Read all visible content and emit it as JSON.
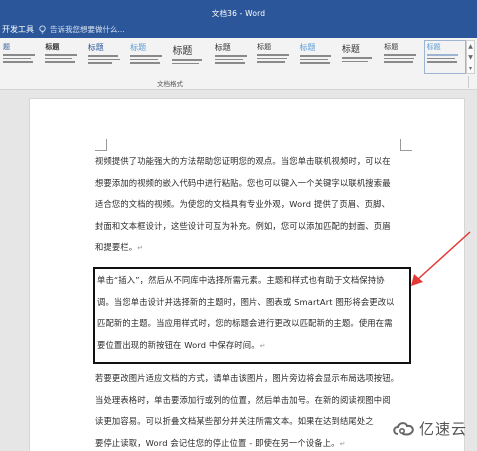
{
  "window": {
    "title": "文档36 - Word"
  },
  "ribbon": {
    "tab_developer": "开发工具",
    "tellme_placeholder": "告诉我您想要做什么...",
    "group_label": "文档格式",
    "styles": [
      "题",
      "标题",
      "标题",
      "标题",
      "标题",
      "标题",
      "标题",
      "标题",
      "标题",
      "标题",
      "标题"
    ]
  },
  "document": {
    "para1_lines": [
      "视频提供了功能强大的方法帮助您证明您的观点。当您单击联机视频时，可以在",
      "想要添加的视频的嵌入代码中进行粘贴。您也可以键入一个关键字以联机搜索最",
      "适合您的文档的视频。为使您的文档具有专业外观，Word 提供了页眉、页脚、",
      "封面和文本框设计，这些设计可互为补充。例如，您可以添加匹配的封面、页眉",
      "和提要栏。"
    ],
    "para2_lines": [
      "单击“插入”，然后从不同库中选择所需元素。主题和样式也有助于文档保持协",
      "调。当您单击设计并选择新的主题时，图片、图表或 SmartArt 图形将会更改以",
      "匹配新的主题。当应用样式时，您的标题会进行更改以匹配新的主题。使用在需",
      "要位置出现的新按钮在 Word 中保存时间。"
    ],
    "para3_lines": [
      "若要更改图片适应文档的方式，请单击该图片，图片旁边将会显示布局选项按钮。",
      "当处理表格时，单击要添加行或列的位置，然后单击加号。在新的阅读视图中阅",
      "读更加容易。可以折叠文档某些部分并关注所需文本。如果在达到结尾处之",
      "要停止读取，Word 会记住您的停止位置 - 即使在另一个设备上。"
    ],
    "paragraph_mark": "↵"
  },
  "watermark": {
    "text": "亿速云"
  },
  "colors": {
    "titlebar": "#2b579a",
    "arrow": "#e53935"
  }
}
